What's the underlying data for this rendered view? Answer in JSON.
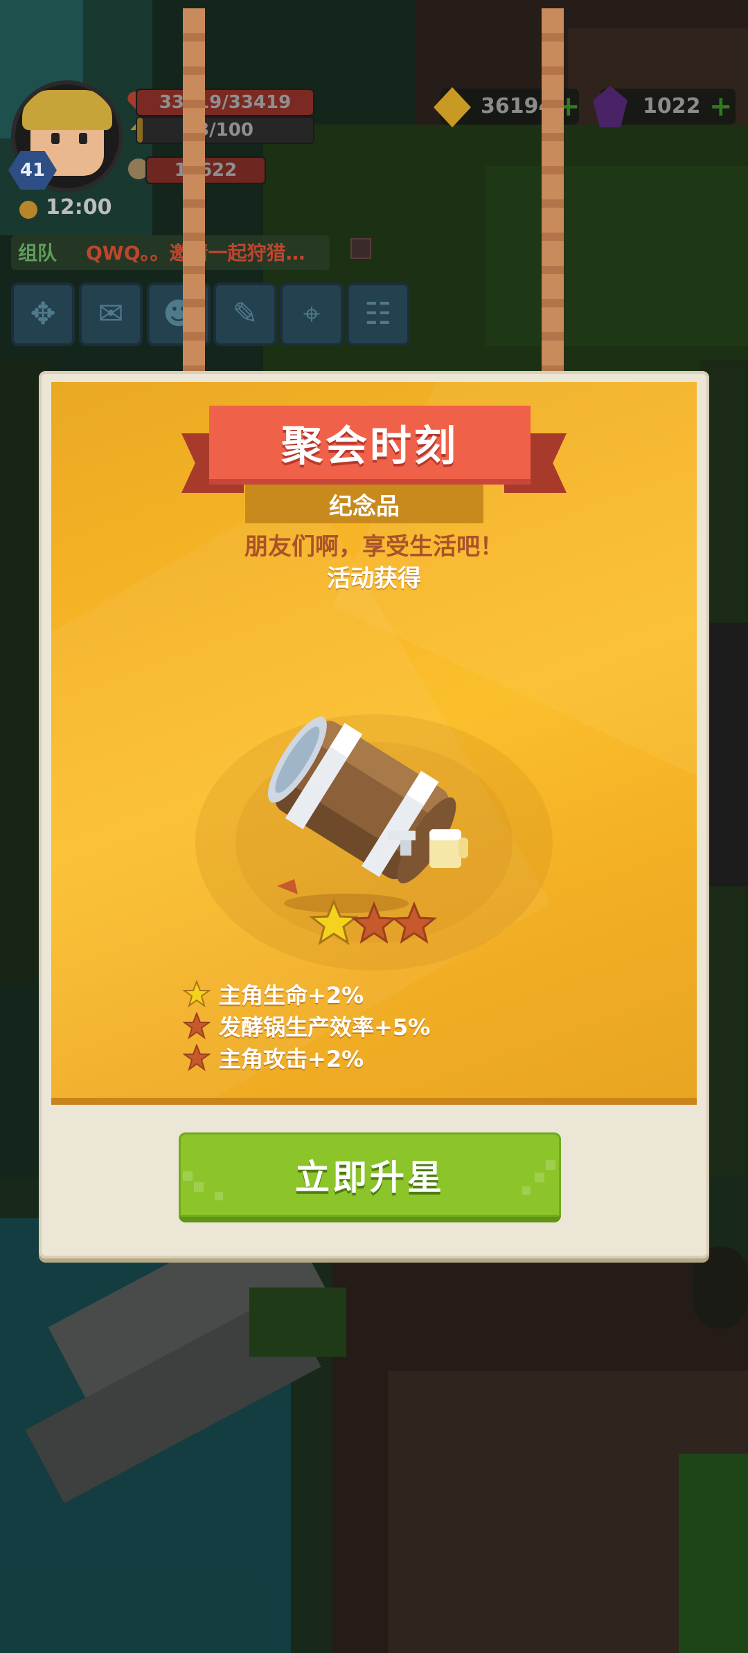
{
  "hud": {
    "level": "41",
    "hp_text": "33419/33419",
    "energy_text": "3/100",
    "power_text": "14622",
    "clock": "12:00",
    "chat_tag": "组队",
    "chat_message": "QWQ。。邀请一起狩猎…",
    "gold_amount": "36194",
    "gem_amount": "1022",
    "buttons": [
      "expand-icon",
      "mail-icon",
      "friends-icon",
      "chat-icon",
      "map-icon",
      "task-icon"
    ]
  },
  "popup": {
    "title": "聚会时刻",
    "subtitle": "纪念品",
    "description": "朋友们啊，享受生活吧！",
    "source": "活动获得",
    "star_level": 1,
    "max_stars": 3,
    "effects": [
      {
        "text": "主角生命+2%",
        "active": true
      },
      {
        "text": "发酵锅生产效率+5%",
        "active": false
      },
      {
        "text": "主角攻击+2%",
        "active": false
      }
    ],
    "upgrade_button": "立即升星"
  },
  "colors": {
    "panel_gold": "#f7b526",
    "title_red": "#f06149",
    "button_green": "#8bc52a",
    "star_active": "#f5d21e",
    "star_inactive": "#c65a2c"
  }
}
